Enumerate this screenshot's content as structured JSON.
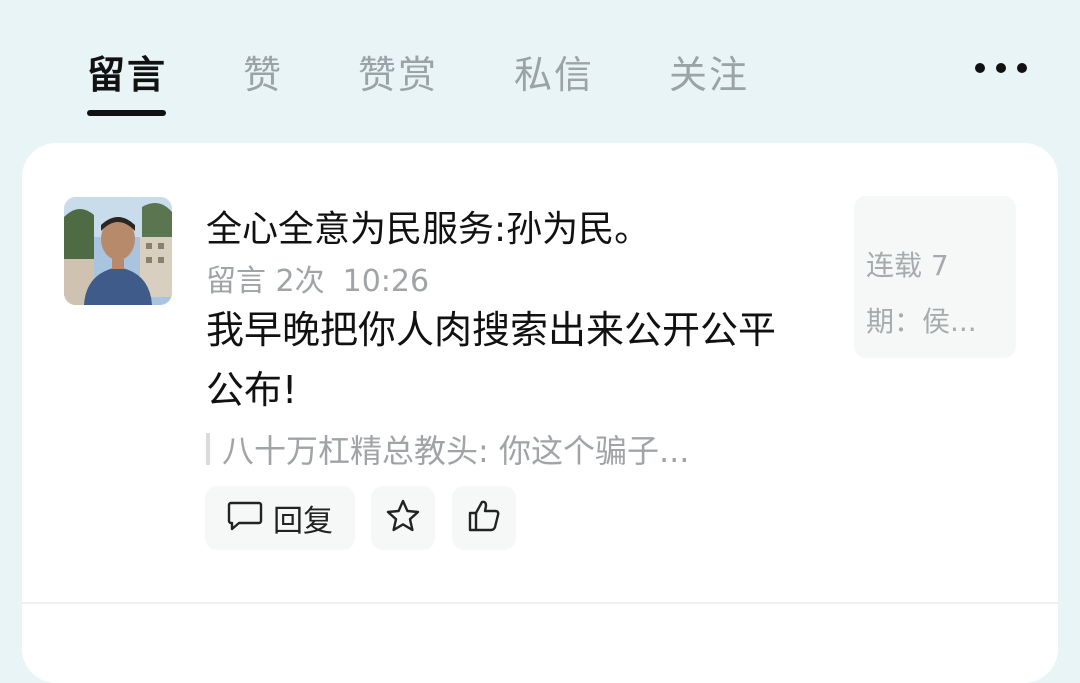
{
  "tabs": [
    {
      "label": "留言",
      "active": true
    },
    {
      "label": "赞",
      "active": false
    },
    {
      "label": "赞赏",
      "active": false
    },
    {
      "label": "私信",
      "active": false
    },
    {
      "label": "关注",
      "active": false
    }
  ],
  "more_icon": "more-horizontal-icon",
  "comment": {
    "author": "全心全意为民服务:孙为民。",
    "meta_prefix": "留言 2次",
    "time": "10:26",
    "content": "我早晚把你人肉搜索出来公开公平公布!",
    "quoted_reply": "八十万杠精总教头: 你这个骗子...",
    "article_preview_line1": "连载 7",
    "article_preview_line2": "期：侯...",
    "reply_label": "回复",
    "icons": {
      "reply": "comment-bubble-icon",
      "star": "star-icon",
      "like": "thumbs-up-icon"
    }
  },
  "colors": {
    "background": "#e8f4f6",
    "card": "#ffffff",
    "active_tab": "#111111",
    "inactive_tab": "#9aa3a6"
  }
}
